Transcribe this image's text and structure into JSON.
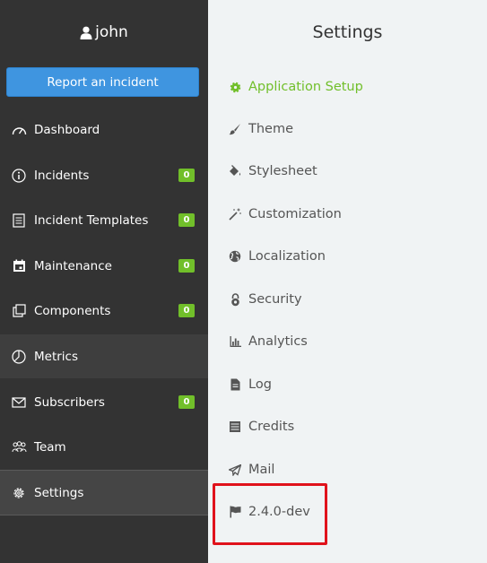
{
  "user": {
    "name": "john",
    "icon": "user-icon"
  },
  "sidebar": {
    "report_button": "Report an incident",
    "items": [
      {
        "label": "Dashboard",
        "icon": "gauge-icon",
        "badge": ""
      },
      {
        "label": "Incidents",
        "icon": "info-circle-icon",
        "badge": "0"
      },
      {
        "label": "Incident Templates",
        "icon": "document-list-icon",
        "badge": "0"
      },
      {
        "label": "Maintenance",
        "icon": "calendar-icon",
        "badge": "0"
      },
      {
        "label": "Components",
        "icon": "copy-icon",
        "badge": "0"
      },
      {
        "label": "Metrics",
        "icon": "pie-chart-icon",
        "badge": ""
      },
      {
        "label": "Subscribers",
        "icon": "envelope-icon",
        "badge": "0"
      },
      {
        "label": "Team",
        "icon": "team-icon",
        "badge": ""
      },
      {
        "label": "Settings",
        "icon": "gear-icon",
        "badge": ""
      }
    ]
  },
  "settings": {
    "title": "Settings",
    "items": [
      {
        "label": "Application Setup",
        "icon": "cog-icon"
      },
      {
        "label": "Theme",
        "icon": "brush-icon"
      },
      {
        "label": "Stylesheet",
        "icon": "paint-bucket-icon"
      },
      {
        "label": "Customization",
        "icon": "magic-wand-icon"
      },
      {
        "label": "Localization",
        "icon": "globe-icon"
      },
      {
        "label": "Security",
        "icon": "lock-icon"
      },
      {
        "label": "Analytics",
        "icon": "bar-chart-icon"
      },
      {
        "label": "Log",
        "icon": "file-icon"
      },
      {
        "label": "Credits",
        "icon": "list-icon"
      },
      {
        "label": "Mail",
        "icon": "paper-plane-icon"
      },
      {
        "label": "2.4.0-dev",
        "icon": "flag-icon"
      }
    ]
  },
  "colors": {
    "sidebar_bg": "#333333",
    "accent_blue": "#3f95e0",
    "badge_green": "#71bf2a",
    "active_green": "#71bf2a",
    "panel_bg": "#f0f3f4",
    "highlight_red": "#e0121b"
  }
}
